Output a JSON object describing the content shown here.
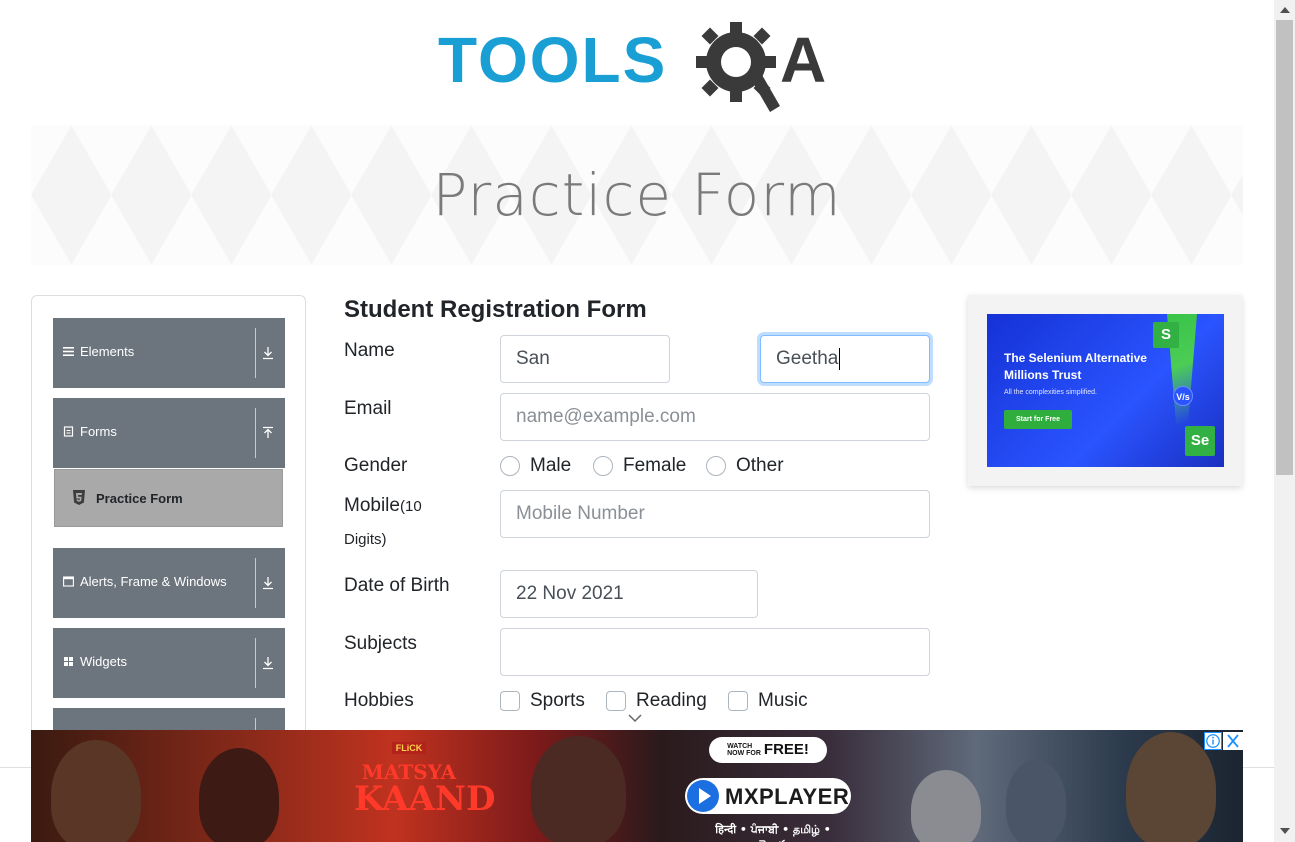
{
  "header": {
    "logo_text": "TOOLS",
    "logo_a": "A",
    "banner_title": "Practice Form"
  },
  "sidebar": {
    "groups": [
      {
        "label": "Elements",
        "icon": "list-icon",
        "arrow": "download-icon"
      },
      {
        "label": "Forms",
        "icon": "form-icon",
        "arrow": "upload-icon"
      },
      {
        "label": "Alerts, Frame & Windows",
        "icon": "window-icon",
        "arrow": "download-icon"
      },
      {
        "label": "Widgets",
        "icon": "widgets-icon",
        "arrow": "download-icon"
      }
    ],
    "active_item": {
      "label": "Practice Form",
      "icon": "html5-icon"
    }
  },
  "form": {
    "title": "Student Registration Form",
    "name_label": "Name",
    "first_name_value": "San",
    "last_name_value": "Geetha",
    "email_label": "Email",
    "email_placeholder": "name@example.com",
    "gender_label": "Gender",
    "gender_options": [
      "Male",
      "Female",
      "Other"
    ],
    "mobile_label": "Mobile",
    "mobile_hint_1": "(10",
    "mobile_hint_2": "Digits)",
    "mobile_placeholder": "Mobile Number",
    "dob_label": "Date of Birth",
    "dob_value": "22 Nov 2021",
    "subjects_label": "Subjects",
    "subjects_value": "",
    "hobbies_label": "Hobbies",
    "hobbies_options": [
      "Sports",
      "Reading",
      "Music"
    ]
  },
  "side_ad": {
    "headline_1": "The Selenium Alternative",
    "headline_2": "Millions Trust",
    "subtext": "All the complexities simplified.",
    "button": "Start for Free",
    "logo_s": "S",
    "logo_se": "Se",
    "vs": "V/s"
  },
  "bottom_ad": {
    "movie_brand": "FLiCK",
    "movie_title_1": "MATSYA",
    "movie_title_2": "KAAND",
    "watch_small_1": "WATCH",
    "watch_small_2": "NOW FOR",
    "watch_free": "FREE!",
    "player": "MXPLAYER",
    "languages": "हिन्दी • ਪੰਜਾਬੀ • தமிழ் • తెలుగు"
  },
  "colors": {
    "brand_blue": "#1a9fd4",
    "sidebar_group_bg": "#6c757d",
    "active_item_bg": "#a9a9a9",
    "focus_border": "#80bdff"
  }
}
